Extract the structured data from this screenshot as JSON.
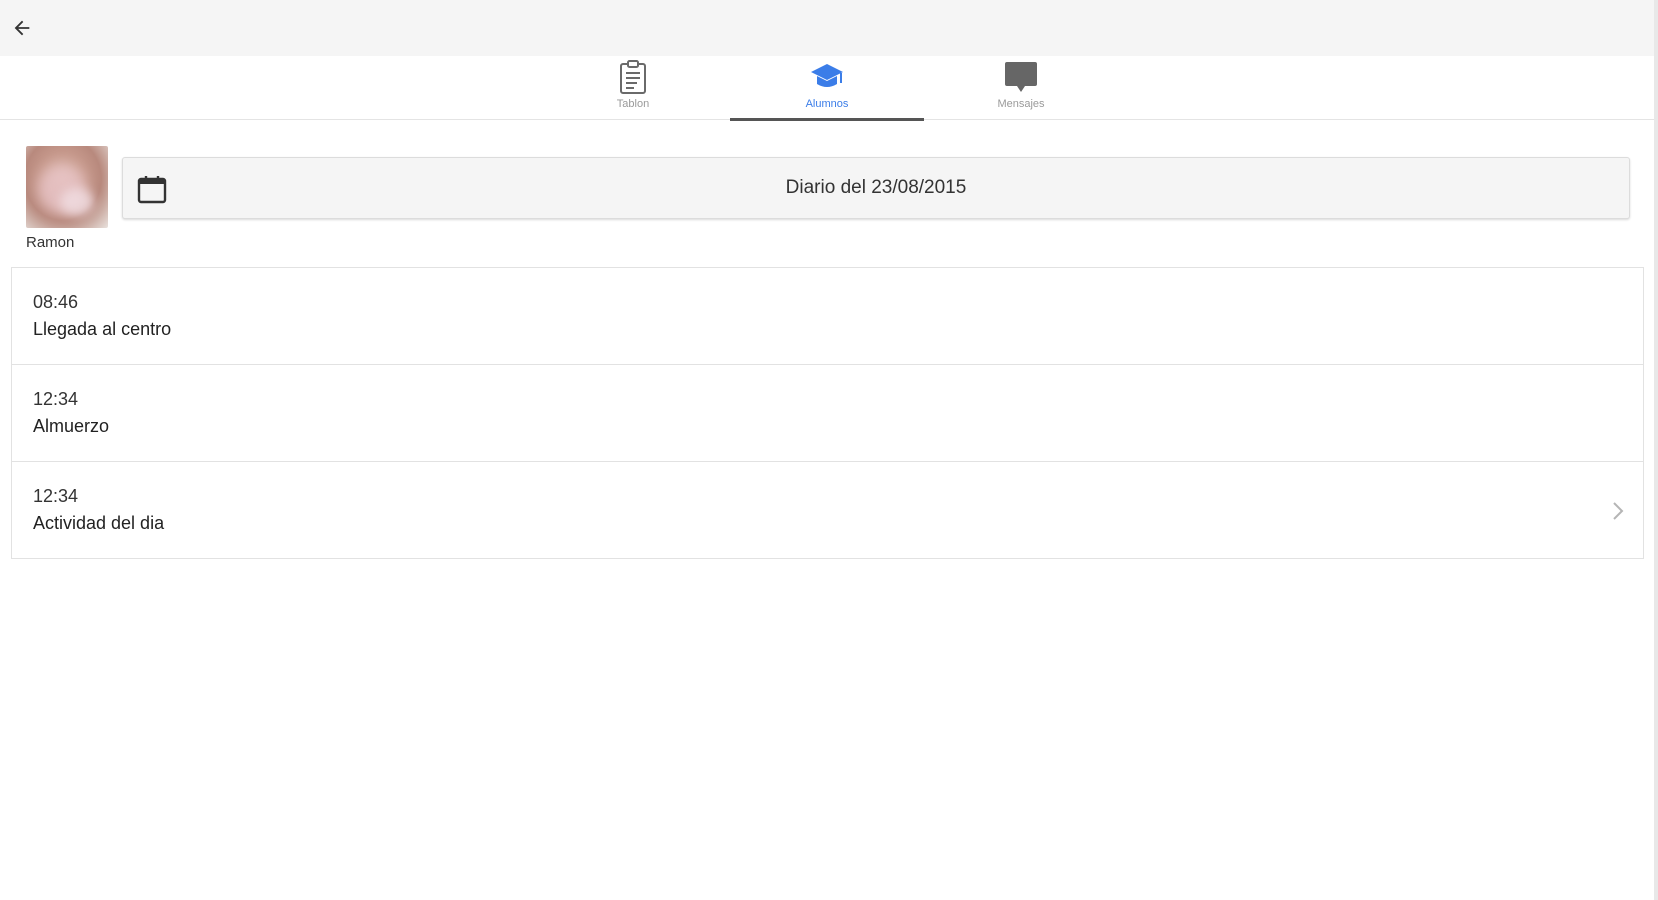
{
  "header": {
    "back_icon": "arrow-left-icon"
  },
  "tabs": [
    {
      "label": "Tablon",
      "icon": "clipboard-icon",
      "active": false
    },
    {
      "label": "Alumnos",
      "icon": "graduation-cap-icon",
      "active": true
    },
    {
      "label": "Mensajes",
      "icon": "chat-bubble-icon",
      "active": false
    }
  ],
  "student": {
    "name": "Ramon"
  },
  "date_selector": {
    "label": "Diario del 23/08/2015",
    "icon": "calendar-icon"
  },
  "events": [
    {
      "time": "08:46",
      "title": "Llegada al centro",
      "has_detail": false
    },
    {
      "time": "12:34",
      "title": "Almuerzo",
      "has_detail": false
    },
    {
      "time": "12:34",
      "title": "Actividad del dia",
      "has_detail": true
    }
  ],
  "colors": {
    "accent": "#3b7de8",
    "tab_indicator": "#555555",
    "topbar": "#f5f5f5"
  }
}
